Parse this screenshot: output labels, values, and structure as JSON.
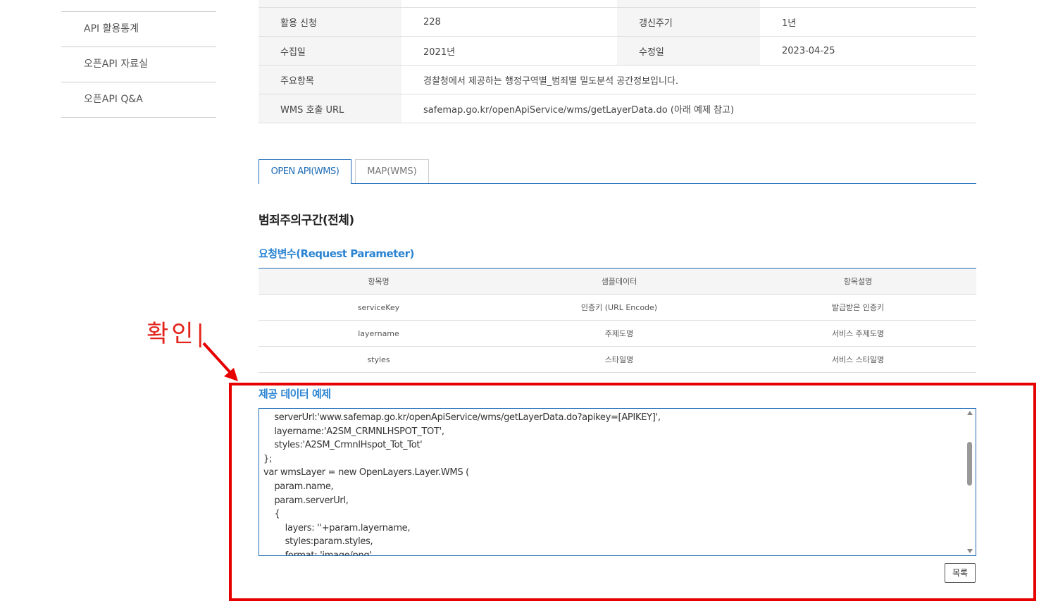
{
  "sidebar": {
    "items": [
      {
        "label": "API 활용통계"
      },
      {
        "label": "오픈API 자료실"
      },
      {
        "label": "오픈API Q&A"
      }
    ]
  },
  "info": {
    "rows": [
      {
        "k1": "활용 신청",
        "v1": "228",
        "k2": "갱신주기",
        "v2": "1년"
      },
      {
        "k1": "수집일",
        "v1": "2021년",
        "k2": "수정일",
        "v2": "2023-04-25"
      },
      {
        "k1": "주요항목",
        "v1": "경찰청에서 제공하는 행정구역별_범죄별 밀도분석 공간정보입니다."
      },
      {
        "k1": "WMS 호출 URL",
        "v1": "safemap.go.kr/openApiService/wms/getLayerData.do (아래 예제 참고)"
      }
    ]
  },
  "tabs": [
    {
      "label": "OPEN API(WMS)",
      "active": true
    },
    {
      "label": "MAP(WMS)",
      "active": false
    }
  ],
  "section_title": "범죄주의구간(전체)",
  "request_title": "요청변수(Request Parameter)",
  "param_table": {
    "headers": [
      "항목명",
      "샘플데이터",
      "항목설명"
    ],
    "rows": [
      [
        "serviceKey",
        "인증키 (URL Encode)",
        "발급받은 인증키"
      ],
      [
        "layername",
        "주제도명",
        "서비스 주제도명"
      ],
      [
        "styles",
        "스타일명",
        "서비스 스타일명"
      ]
    ]
  },
  "example_title": "제공 데이터 예제",
  "code_lines": [
    "    serverUrl:'www.safemap.go.kr/openApiService/wms/getLayerData.do?apikey=[APIKEY]',",
    "    layername:'A2SM_CRMNLHSPOT_TOT',",
    "    styles:'A2SM_CrmnlHspot_Tot_Tot'",
    "};",
    "var wmsLayer = new OpenLayers.Layer.WMS (",
    "    param.name,",
    "    param.serverUrl,",
    "    {",
    "        layers: ''+param.layername,",
    "        styles:param.styles,",
    "        format: 'image/png',"
  ],
  "list_button": "목록",
  "annotation": {
    "label": "확인|",
    "color": "#e60000"
  },
  "colors": {
    "accent": "#1c6ab4",
    "link": "#2a84d2"
  }
}
